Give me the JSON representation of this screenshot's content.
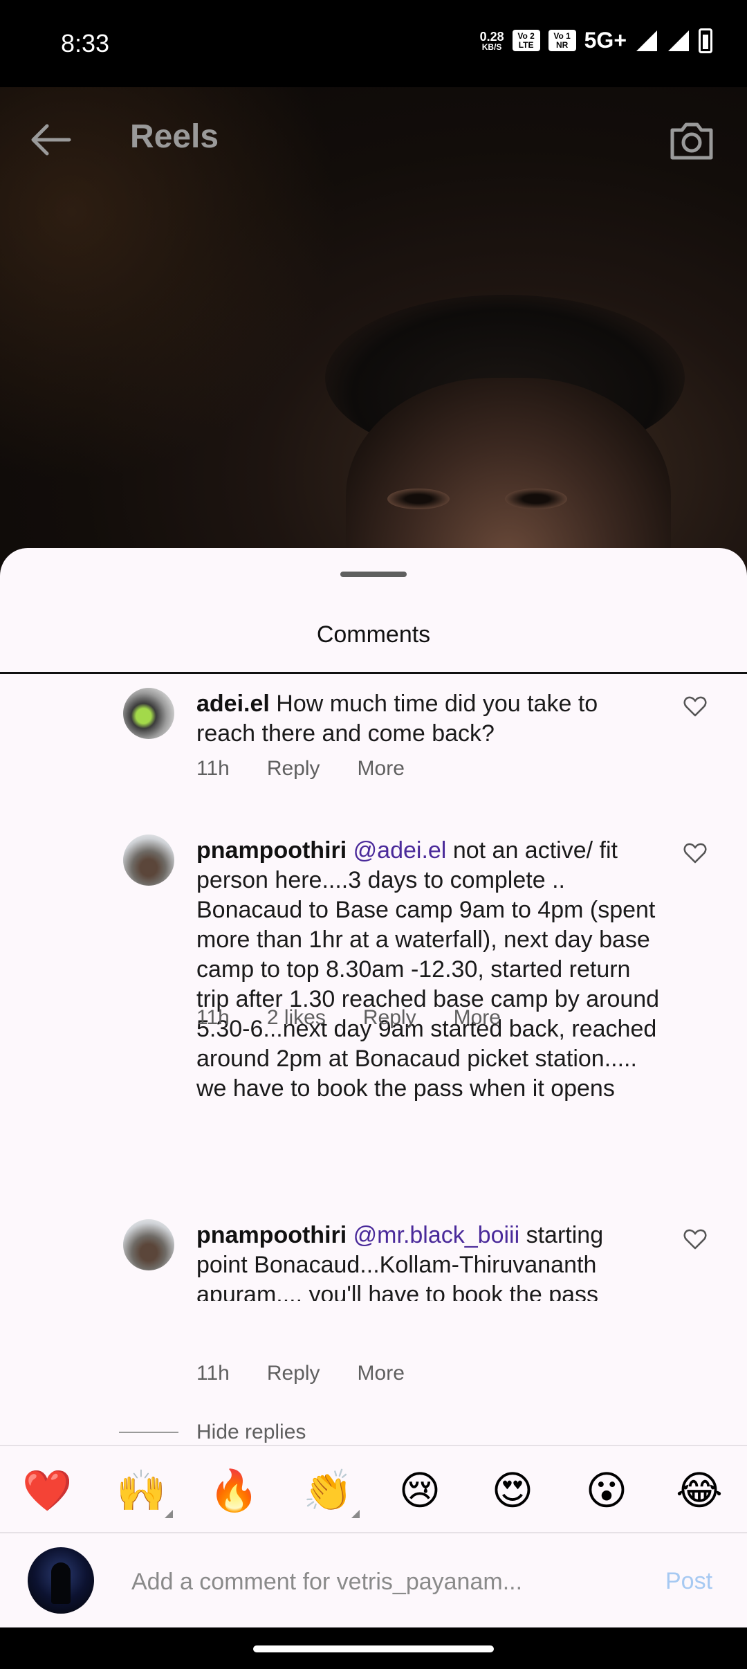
{
  "status_bar": {
    "time": "8:33",
    "net_speed_value": "0.28",
    "net_speed_unit": "KB/S",
    "sim1_chip": "Vo 2\nLTE",
    "sim2_chip": "Vo 1\nNR",
    "network": "5G+"
  },
  "header": {
    "title": "Reels"
  },
  "sheet": {
    "title": "Comments"
  },
  "comments": [
    {
      "user": "adei.el",
      "mention": "",
      "text": "How much time did you take to reach there and come back?",
      "time": "11h",
      "likes": "",
      "reply": "Reply",
      "more": "More"
    },
    {
      "user": "pnampoothiri",
      "mention": "@adei.el",
      "text": "not an active/ fit person here....3 days to complete .. Bonacaud to Base camp 9am to 4pm (spent more than 1hr at a waterfall), next day base camp to top 8.30am -12.30, started return trip after 1.30 reached base camp by around 5.30-6...next day 9am started back, reached around 2pm at Bonacaud picket station..... we have to book the pass when it opens",
      "time": "11h",
      "likes": "2 likes",
      "reply": "Reply",
      "more": "More"
    },
    {
      "user": "pnampoothiri",
      "mention": "@mr.black_boiii",
      "text": "starting point Bonacaud...Kollam-Thiruvananth apuram.... you'll have to book the pass when it opens.",
      "time": "11h",
      "likes": "",
      "reply": "Reply",
      "more": "More"
    }
  ],
  "hide_replies": "Hide replies",
  "emojis": [
    "❤️",
    "🙌",
    "🔥",
    "👏",
    "😢",
    "😍",
    "😮",
    "😂"
  ],
  "composer": {
    "placeholder": "Add a comment for vetris_payanam...",
    "post_label": "Post"
  },
  "colors": {
    "sheet_bg": "#fdf8fc",
    "mention": "#4a2a9a",
    "post_disabled": "#a6c9f2",
    "meta_text": "#5f5f5f"
  }
}
